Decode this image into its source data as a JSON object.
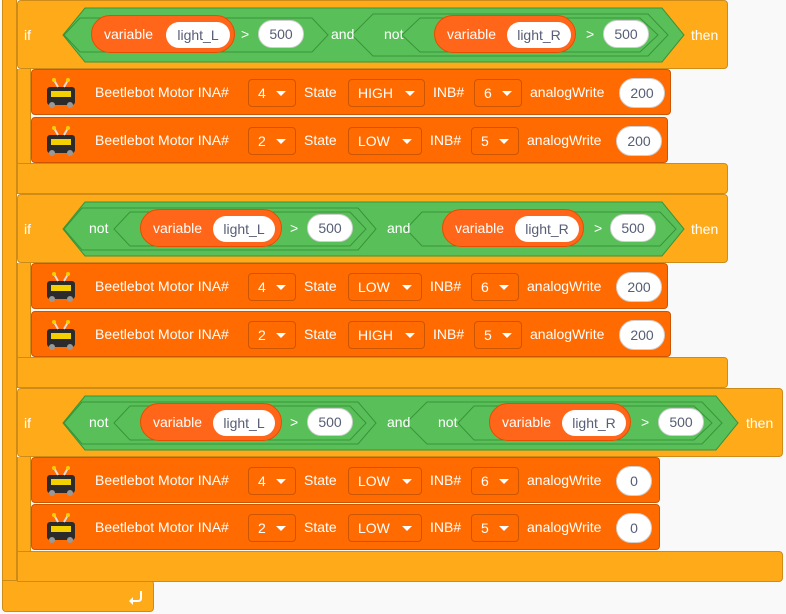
{
  "keywords": {
    "if": "if",
    "then": "then",
    "and": "and",
    "not": "not",
    "variable": "variable"
  },
  "operators": {
    "gt": ">"
  },
  "conditions": [
    {
      "left": {
        "var": "light_L",
        "value": "500"
      },
      "right": {
        "var": "light_R",
        "value": "500"
      }
    },
    {
      "left": {
        "var": "light_L",
        "value": "500"
      },
      "right": {
        "var": "light_R",
        "value": "500"
      }
    },
    {
      "left": {
        "var": "light_L",
        "value": "500"
      },
      "right": {
        "var": "light_R",
        "value": "500"
      }
    }
  ],
  "motor_labels": {
    "block": "Beetlebot Motor INA#",
    "state": "State",
    "inb": "INB#",
    "analog": "analogWrite"
  },
  "motors": [
    {
      "ina": "4",
      "state": "HIGH",
      "inb": "6",
      "pwm": "200"
    },
    {
      "ina": "2",
      "state": "LOW",
      "inb": "5",
      "pwm": "200"
    },
    {
      "ina": "4",
      "state": "LOW",
      "inb": "6",
      "pwm": "200"
    },
    {
      "ina": "2",
      "state": "HIGH",
      "inb": "5",
      "pwm": "200"
    },
    {
      "ina": "4",
      "state": "LOW",
      "inb": "6",
      "pwm": "0"
    },
    {
      "ina": "2",
      "state": "LOW",
      "inb": "5",
      "pwm": "0"
    }
  ],
  "icons": {
    "loop": "loop-arrow-icon",
    "robot": "beetlebot-robot-icon"
  },
  "colors": {
    "control": "#ffab19",
    "operator": "#59c059",
    "variable": "#ff661a",
    "motor": "#ff6b00"
  }
}
